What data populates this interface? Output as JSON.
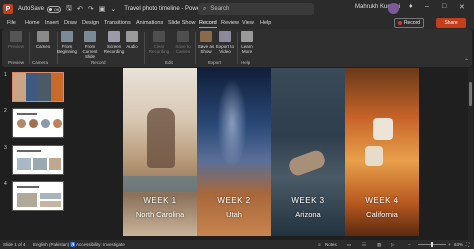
{
  "titlebar": {
    "autosave": "AutoSave",
    "toggle": "Off",
    "doc_title": "Travel photo timeline - PowerP...",
    "search_placeholder": "Search",
    "user": "Mahrukh Kureshi"
  },
  "tabs": [
    "File",
    "Home",
    "Insert",
    "Draw",
    "Design",
    "Transitions",
    "Animations",
    "Slide Show",
    "Record",
    "Review",
    "View",
    "Help"
  ],
  "active_tab": "Record",
  "record_button": "Record",
  "share_button": "Share",
  "ribbon": {
    "items": [
      {
        "label": "Preview",
        "enabled": false
      },
      {
        "label": "Cameo",
        "enabled": true
      },
      {
        "label": "From Beginning",
        "enabled": true
      },
      {
        "label": "From Current Slide",
        "enabled": true
      },
      {
        "label": "Screen Recording",
        "enabled": true
      },
      {
        "label": "Audio",
        "enabled": true
      },
      {
        "label": "Clear Recording",
        "enabled": false
      },
      {
        "label": "Save to Cameo",
        "enabled": false
      },
      {
        "label": "Save as Show",
        "enabled": true
      },
      {
        "label": "Export to Video",
        "enabled": true
      },
      {
        "label": "Learn More",
        "enabled": true
      }
    ],
    "groups": [
      "Preview",
      "Camera",
      "Record",
      "Edit",
      "Export",
      "Help"
    ]
  },
  "thumbnails": [
    "1",
    "2",
    "3",
    "4"
  ],
  "slide": {
    "panels": [
      {
        "week": "WEEK 1",
        "place": "North Carolina"
      },
      {
        "week": "WEEK 2",
        "place": "Utah"
      },
      {
        "week": "WEEK 3",
        "place": "Arizona"
      },
      {
        "week": "WEEK 4",
        "place": "California"
      }
    ]
  },
  "status": {
    "slide_pos": "Slide 1 of 4",
    "language": "English (Pakistan)",
    "accessibility": "Accessibility: Investigate",
    "notes": "Notes",
    "zoom": "63%"
  }
}
